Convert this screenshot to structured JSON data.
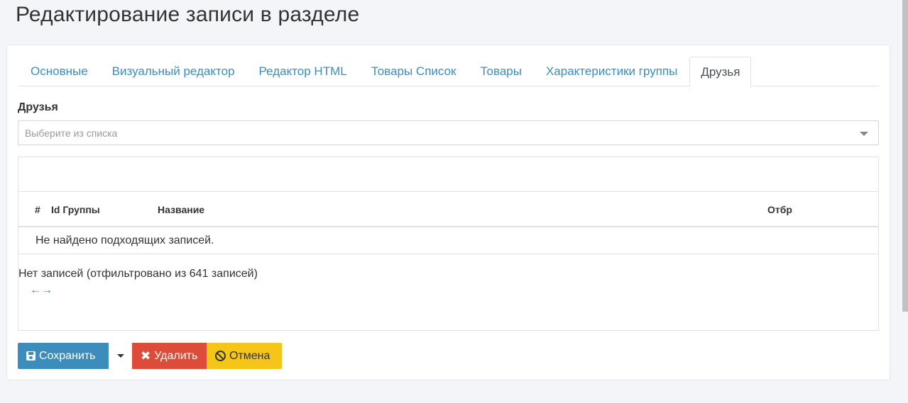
{
  "page": {
    "title": "Редактирование записи в разделе"
  },
  "tabs": [
    {
      "label": "Основные"
    },
    {
      "label": "Визуальный редактор"
    },
    {
      "label": "Редактор HTML"
    },
    {
      "label": "Товары Список"
    },
    {
      "label": "Товары"
    },
    {
      "label": "Характеристики группы"
    },
    {
      "label": "Друзья",
      "active": true
    }
  ],
  "friends": {
    "label": "Друзья",
    "select_placeholder": "Выберите из списка"
  },
  "table": {
    "columns": [
      "#",
      "Id Группы",
      "Название",
      "Отбр"
    ],
    "empty_text": "Не найдено подходящих записей.",
    "info": "Нет записей (отфильтровано из 641 записей)",
    "pager_prev": "←",
    "pager_next": "→"
  },
  "buttons": {
    "save": "Сохранить",
    "delete": "Удалить",
    "cancel": "Отмена"
  },
  "colors": {
    "primary": "#3c8dbc",
    "danger": "#dd4b39",
    "warning": "#f5c518"
  },
  "icons": {
    "save": "floppy-disk-icon",
    "delete": "x-icon",
    "cancel": "ban-icon",
    "select": "chevron-down-icon",
    "split": "caret-down-icon"
  }
}
